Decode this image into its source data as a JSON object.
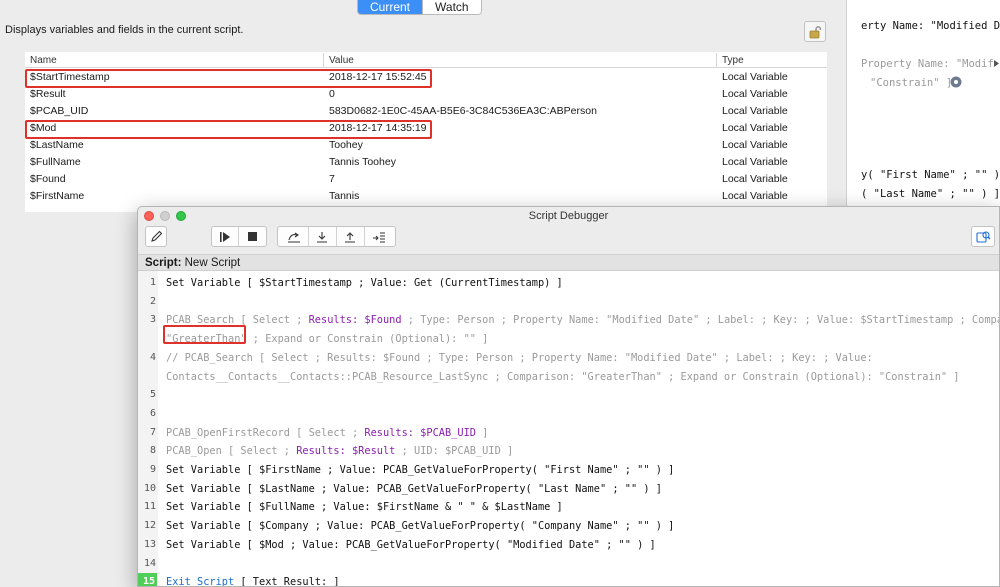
{
  "data_viewer": {
    "tabs": [
      "Current",
      "Watch"
    ],
    "active_tab": "Current",
    "description": "Displays variables and fields in the current script.",
    "lock_icon": "lock-icon",
    "columns": [
      "Name",
      "Value",
      "Type"
    ],
    "rows": [
      {
        "name": "$StartTimestamp",
        "value": "2018-12-17 15:52:45",
        "type": "Local Variable",
        "highlighted": true
      },
      {
        "name": "$Result",
        "value": "0",
        "type": "Local Variable",
        "highlighted": false
      },
      {
        "name": "$PCAB_UID",
        "value": "583D0682-1E0C-45AA-B5E6-3C84C536EA3C:ABPerson",
        "type": "Local Variable",
        "highlighted": false
      },
      {
        "name": "$Mod",
        "value": "2018-12-17 14:35:19",
        "type": "Local Variable",
        "highlighted": true
      },
      {
        "name": "$LastName",
        "value": "Toohey",
        "type": "Local Variable",
        "highlighted": false
      },
      {
        "name": "$FullName",
        "value": "Tannis Toohey",
        "type": "Local Variable",
        "highlighted": false
      },
      {
        "name": "$Found",
        "value": "7",
        "type": "Local Variable",
        "highlighted": false
      },
      {
        "name": "$FirstName",
        "value": "Tannis",
        "type": "Local Variable",
        "highlighted": false
      }
    ]
  },
  "background_window": {
    "lines": [
      {
        "text": "erty Name: \"Modified Date",
        "dim": false
      },
      {
        "text": "Property Name: \"Modified D",
        "dim": true
      },
      {
        "text": "\"Constrain\" ]",
        "dim": true
      },
      {
        "text": "y( \"First Name\" ; \"\" ) ]",
        "dim": false
      },
      {
        "text": "( \"Last Name\" ; \"\" ) ]",
        "dim": false
      }
    ]
  },
  "debugger": {
    "window_title": "Script Debugger",
    "script_label": "Script:",
    "script_name": "New Script",
    "current_line": 15,
    "colors": {
      "current_line": "#4fcf5a",
      "highlight_box": "#e0302a",
      "accent": "#3b8ff6"
    },
    "lines": [
      {
        "num": "1",
        "segments": [
          {
            "t": "Set Variable [ $StartTimestamp ; Value: Get (CurrentTimestamp) ]",
            "c": ""
          }
        ]
      },
      {
        "num": "2",
        "segments": []
      },
      {
        "num": "3",
        "segments": [
          {
            "t": "PCAB_Search [ Select ; ",
            "c": "dim"
          },
          {
            "t": "Results: $Found",
            "c": "purple"
          },
          {
            "t": " ; Type: Person ; Property Name: \"Modified Date\" ; Label:    ; Key:    ; Value: $StartTimestamp ; Comparison:",
            "c": "dim"
          }
        ]
      },
      {
        "num": "",
        "segments": [
          {
            "t": "\"GreaterThan\"",
            "c": "dim"
          },
          {
            "t": " ; Expand or Constrain (Optional): \"\" ]",
            "c": "dim"
          }
        ]
      },
      {
        "num": "4",
        "segments": [
          {
            "t": "// PCAB_Search [ Select ; Results: $Found ; Type: Person ; Property Name: \"Modified Date\" ; Label:    ; Key:    ; Value:",
            "c": "dim"
          }
        ]
      },
      {
        "num": "",
        "segments": [
          {
            "t": "Contacts__Contacts__Contacts::PCAB_Resource_LastSync ; Comparison: \"GreaterThan\" ; Expand or Constrain (Optional): \"Constrain\" ]",
            "c": "dim"
          }
        ]
      },
      {
        "num": "5",
        "segments": []
      },
      {
        "num": "6",
        "segments": []
      },
      {
        "num": "7",
        "segments": [
          {
            "t": "PCAB_OpenFirstRecord [ Select ; ",
            "c": "dim"
          },
          {
            "t": "Results: $PCAB_UID",
            "c": "purple"
          },
          {
            "t": " ]",
            "c": "dim"
          }
        ]
      },
      {
        "num": "8",
        "segments": [
          {
            "t": "PCAB_Open [ Select ; ",
            "c": "dim"
          },
          {
            "t": "Results: $Result",
            "c": "purple"
          },
          {
            "t": " ; UID: $PCAB_UID ]",
            "c": "dim"
          }
        ]
      },
      {
        "num": "9",
        "segments": [
          {
            "t": "Set Variable [ $FirstName ; Value: PCAB_GetValueForProperty( \"First Name\" ; \"\" ) ]",
            "c": ""
          }
        ]
      },
      {
        "num": "10",
        "segments": [
          {
            "t": "Set Variable [ $LastName ; Value: PCAB_GetValueForProperty( \"Last Name\" ; \"\" ) ]",
            "c": ""
          }
        ]
      },
      {
        "num": "11",
        "segments": [
          {
            "t": "Set Variable [ $FullName ; Value: $FirstName & \" \" & $LastName ]",
            "c": ""
          }
        ]
      },
      {
        "num": "12",
        "segments": [
          {
            "t": "Set Variable [ $Company ; Value: PCAB_GetValueForProperty( \"Company Name\" ; \"\" ) ]",
            "c": ""
          }
        ]
      },
      {
        "num": "13",
        "segments": [
          {
            "t": "Set Variable [ $Mod ; Value: PCAB_GetValueForProperty( \"Modified Date\" ; \"\" ) ]",
            "c": ""
          }
        ]
      },
      {
        "num": "14",
        "segments": []
      },
      {
        "num": "15",
        "segments": [
          {
            "t": "Exit Script",
            "c": "blue"
          },
          {
            "t": " [ Text Result: ]",
            "c": ""
          }
        ]
      }
    ]
  }
}
